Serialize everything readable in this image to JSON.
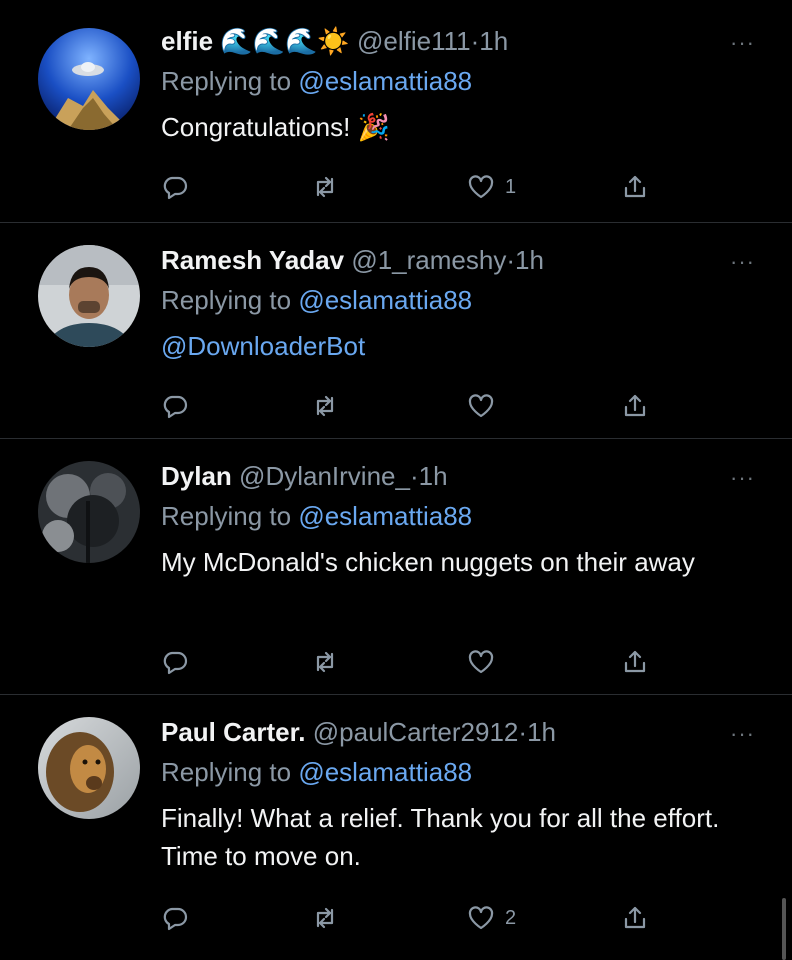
{
  "tweets": [
    {
      "name": "elfie 🌊🌊🌊☀️",
      "handle": "@elfie111",
      "separator": "·",
      "time": "1h",
      "replying_prefix": "Replying to",
      "replying_to": "@eslamattia88",
      "text": "Congratulations! 🎉",
      "text_is_link": false,
      "likes": "1",
      "avatar_icon": "ufo-over-mountain-avatar"
    },
    {
      "name": "Ramesh Yadav",
      "handle": "@1_rameshy",
      "separator": "·",
      "time": "1h",
      "replying_prefix": "Replying to",
      "replying_to": "@eslamattia88",
      "text": "@DownloaderBot",
      "text_is_link": true,
      "likes": "",
      "avatar_icon": "person-photo-avatar"
    },
    {
      "name": "Dylan",
      "handle": "@DylanIrvine_",
      "separator": "·",
      "time": "1h",
      "replying_prefix": "Replying to",
      "replying_to": "@eslamattia88",
      "text": "My McDonald's chicken nuggets on their away",
      "text_is_link": false,
      "likes": "",
      "avatar_icon": "forest-photo-avatar"
    },
    {
      "name": "Paul Carter.",
      "handle": "@paulCarter2912",
      "separator": "·",
      "time": "1h",
      "replying_prefix": "Replying to",
      "replying_to": "@eslamattia88",
      "text": "Finally! What a relief. Thank you for all the effort. Time to move on.",
      "text_is_link": false,
      "likes": "2",
      "avatar_icon": "lion-photo-avatar"
    }
  ],
  "more_label": "···",
  "colors": {
    "background": "#000000",
    "text": "#f2f3f4",
    "secondary": "#8b98a5",
    "link": "#6aa8f0",
    "divider": "#2a2d31"
  }
}
